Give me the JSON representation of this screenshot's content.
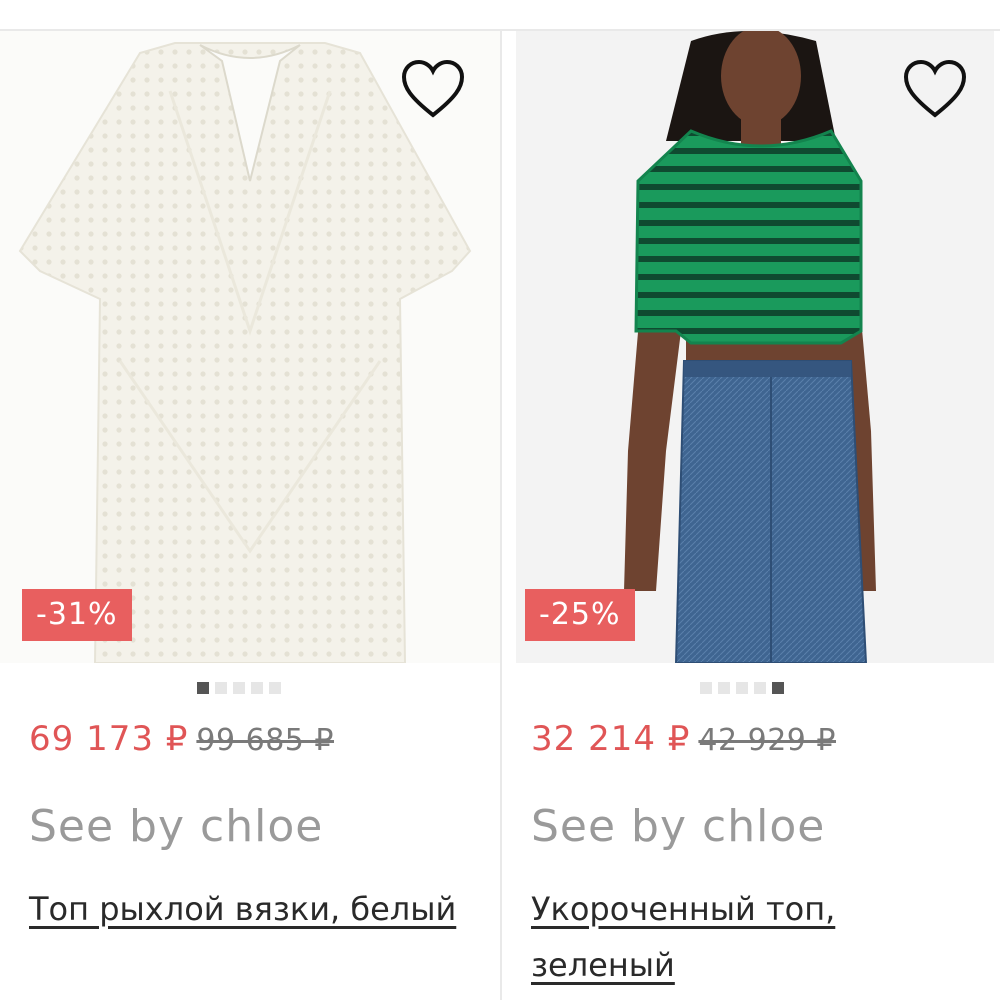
{
  "products": [
    {
      "discount": "-31%",
      "price_new": "69 173 ₽",
      "price_old": "99 685 ₽",
      "brand": "See by chloe",
      "title": "Топ рыхлой вязки, белый",
      "image_dots": {
        "count": 5,
        "active": 0
      },
      "favorite_icon": "heart-outline-icon",
      "garment_color": "#f4f2ea"
    },
    {
      "discount": "-25%",
      "price_new": "32 214 ₽",
      "price_old": "42 929 ₽",
      "brand": "See by chloe",
      "title": "Укороченный топ, зеленый",
      "image_dots": {
        "count": 5,
        "active": 4
      },
      "favorite_icon": "heart-outline-icon",
      "garment_color": "#1a9a5c"
    }
  ],
  "colors": {
    "discount_badge": "#e85f5f",
    "price_new": "#e05556",
    "brand": "#9a9a9a",
    "dot_active": "#555555",
    "dot_inactive": "#e6e6e6"
  }
}
